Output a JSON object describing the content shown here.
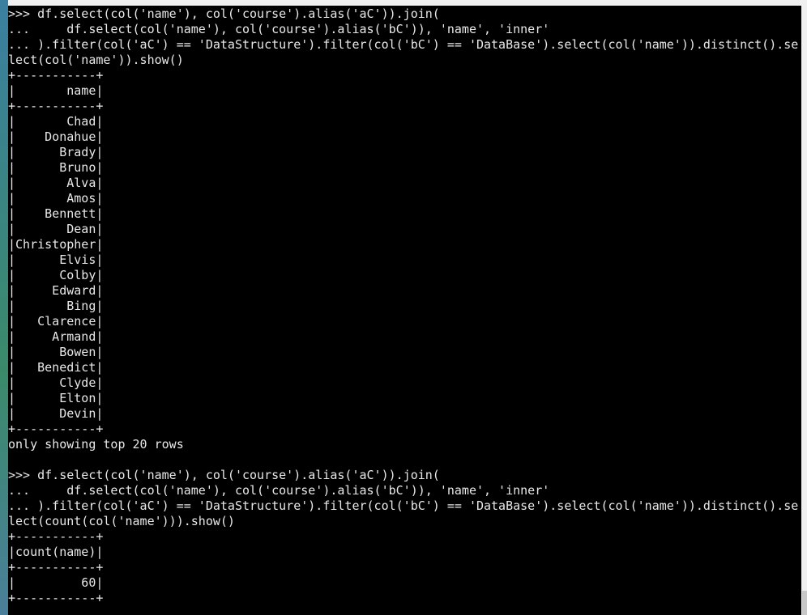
{
  "terminal": {
    "lines": [
      ">>> df.select(col('name'), col('course').alias('aC')).join(",
      "...     df.select(col('name'), col('course').alias('bC')), 'name', 'inner'",
      "... ).filter(col('aC') == 'DataStructure').filter(col('bC') == 'DataBase').select(col('name')).distinct().se",
      "lect(col('name')).show()",
      "+-----------+",
      "|       name|",
      "+-----------+",
      "|       Chad|",
      "|    Donahue|",
      "|      Brady|",
      "|      Bruno|",
      "|       Alva|",
      "|       Amos|",
      "|    Bennett|",
      "|       Dean|",
      "|Christopher|",
      "|      Elvis|",
      "|      Colby|",
      "|     Edward|",
      "|       Bing|",
      "|   Clarence|",
      "|     Armand|",
      "|      Bowen|",
      "|   Benedict|",
      "|      Clyde|",
      "|      Elton|",
      "|      Devin|",
      "+-----------+",
      "only showing top 20 rows",
      "",
      ">>> df.select(col('name'), col('course').alias('aC')).join(",
      "...     df.select(col('name'), col('course').alias('bC')), 'name', 'inner'",
      "... ).filter(col('aC') == 'DataStructure').filter(col('bC') == 'DataBase').select(col('name')).distinct().se",
      "lect(count(col('name'))).show()",
      "+-----------+",
      "|count(name)|",
      "+-----------+",
      "|         60|",
      "+-----------+"
    ]
  }
}
